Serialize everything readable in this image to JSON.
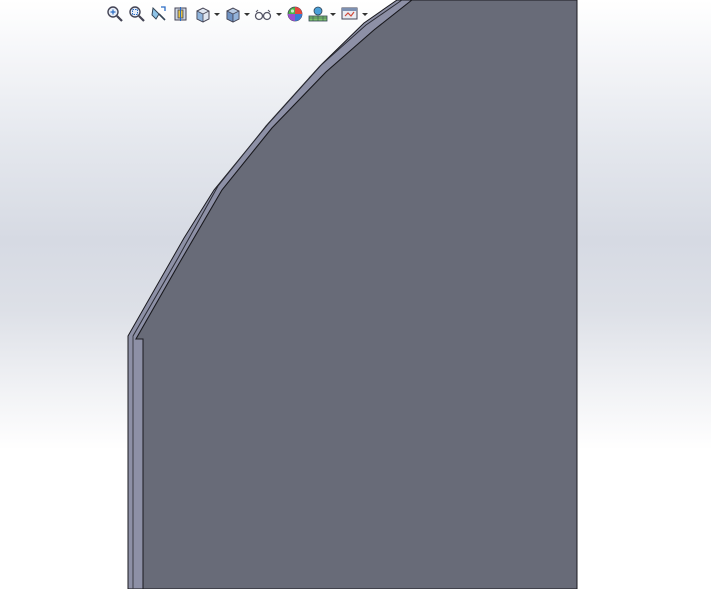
{
  "app": {
    "viewport_name": "graphics-area"
  },
  "heads_up_toolbar": {
    "tools": [
      {
        "icon": "zoom-to-fit-icon",
        "has_dropdown": false
      },
      {
        "icon": "zoom-to-area-icon",
        "has_dropdown": false
      },
      {
        "icon": "previous-view-icon",
        "has_dropdown": false
      },
      {
        "icon": "section-view-icon",
        "has_dropdown": false
      },
      {
        "icon": "view-orientation-icon",
        "has_dropdown": true
      },
      {
        "icon": "display-style-icon",
        "has_dropdown": true
      },
      {
        "icon": "hide-show-items-icon",
        "has_dropdown": true
      },
      {
        "icon": "edit-appearance-icon",
        "has_dropdown": false
      },
      {
        "icon": "apply-scene-icon",
        "has_dropdown": true
      },
      {
        "icon": "view-settings-icon",
        "has_dropdown": true
      }
    ]
  },
  "colors": {
    "model_face": "#686b78",
    "model_edge_face": "#8d90a6",
    "model_outline": "#1a1a1f",
    "background_top": "#ffffff",
    "background_mid": "#d6dae3"
  }
}
